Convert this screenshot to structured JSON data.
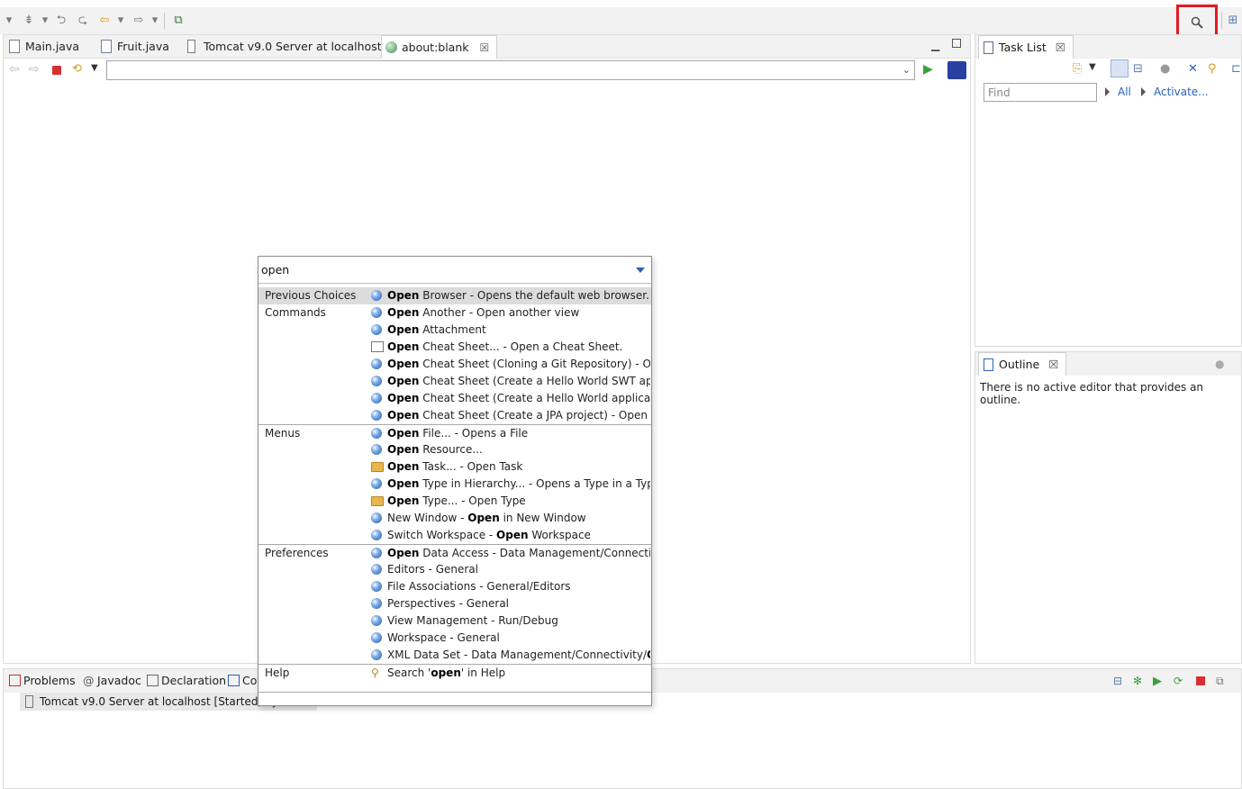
{
  "toolbar": {
    "search_tooltip": "Quick Access"
  },
  "editor_tabs": [
    {
      "label": "Main.java"
    },
    {
      "label": "Fruit.java"
    },
    {
      "label": "Tomcat v9.0 Server at localhost"
    },
    {
      "label": "about:blank",
      "close": "☒"
    }
  ],
  "browser": {
    "url": ""
  },
  "task_list": {
    "title": "Task List",
    "close": "☒",
    "find_placeholder": "Find",
    "all_label": "All",
    "activate_label": "Activate..."
  },
  "outline": {
    "title": "Outline",
    "close": "☒",
    "message": "There is no active editor that provides an outline."
  },
  "bottom_tabs": [
    {
      "label": "Problems"
    },
    {
      "label": "Javadoc"
    },
    {
      "label": "Declaration"
    },
    {
      "label": "Co"
    }
  ],
  "console": {
    "row": "Tomcat v9.0 Server at localhost  [Started, Sy"
  },
  "quick_access": {
    "query": "open",
    "rows": [
      {
        "category": "Previous Choices",
        "icon": "globe-icon",
        "bold": "Open",
        "rest": " Browser - Opens the default web browser.",
        "selected": true,
        "group_start": false
      },
      {
        "category": "Commands",
        "icon": "command-icon",
        "bold": "Open",
        "rest": " Another - Open another view",
        "group_start": false
      },
      {
        "category": "",
        "icon": "command-icon",
        "bold": "Open",
        "rest": " Attachment"
      },
      {
        "category": "",
        "icon": "cheat-sheet-icon",
        "bold": "Open",
        "rest": " Cheat Sheet... - Open a Cheat Sheet."
      },
      {
        "category": "",
        "icon": "command-icon",
        "bold": "Open",
        "rest": " Cheat Sheet (Cloning a Git Repository) - Open a"
      },
      {
        "category": "",
        "icon": "command-icon",
        "bold": "Open",
        "rest": " Cheat Sheet (Create a Hello World SWT applica"
      },
      {
        "category": "",
        "icon": "command-icon",
        "bold": "Open",
        "rest": " Cheat Sheet (Create a Hello World application)"
      },
      {
        "category": "",
        "icon": "command-icon",
        "bold": "Open",
        "rest": " Cheat Sheet (Create a JPA project) - Open a Ch"
      },
      {
        "category": "Menus",
        "icon": "command-icon",
        "bold": "Open",
        "rest": " File... - Opens a File",
        "group_start": true
      },
      {
        "category": "",
        "icon": "command-icon",
        "bold": "Open",
        "rest": " Resource..."
      },
      {
        "category": "",
        "icon": "task-folder-icon",
        "bold": "Open",
        "rest": " Task... - Open Task"
      },
      {
        "category": "",
        "icon": "command-icon",
        "bold": "Open",
        "rest": " Type in Hierarchy... - Opens a Type in a Type H"
      },
      {
        "category": "",
        "icon": "type-folder-icon",
        "bold": "Open",
        "rest": " Type... - Open Type"
      },
      {
        "category": "",
        "icon": "command-icon",
        "pre": "New Window - ",
        "bold": "Open",
        "rest": " in New Window"
      },
      {
        "category": "",
        "icon": "command-icon",
        "pre": "Switch Workspace - ",
        "bold": "Open",
        "rest": " Workspace"
      },
      {
        "category": "Preferences",
        "icon": "command-icon",
        "bold": "Open",
        "rest": " Data Access - Data Management/Connectivity",
        "group_start": true
      },
      {
        "category": "",
        "icon": "command-icon",
        "pre": "Editors - General",
        "bold": "",
        "rest": ""
      },
      {
        "category": "",
        "icon": "command-icon",
        "pre": "File Associations - General/Editors",
        "bold": "",
        "rest": ""
      },
      {
        "category": "",
        "icon": "command-icon",
        "pre": "Perspectives - General",
        "bold": "",
        "rest": ""
      },
      {
        "category": "",
        "icon": "command-icon",
        "pre": "View Management - Run/Debug",
        "bold": "",
        "rest": ""
      },
      {
        "category": "",
        "icon": "command-icon",
        "pre": "Workspace - General",
        "bold": "",
        "rest": ""
      },
      {
        "category": "",
        "icon": "command-icon",
        "pre": "XML Data Set - Data Management/Connectivity/",
        "bold": "Ope",
        "rest": ""
      },
      {
        "category": "Help",
        "icon": "help-search-icon",
        "pre": "Search '",
        "bold": "open",
        "rest": "' in Help",
        "group_start": true
      }
    ]
  }
}
